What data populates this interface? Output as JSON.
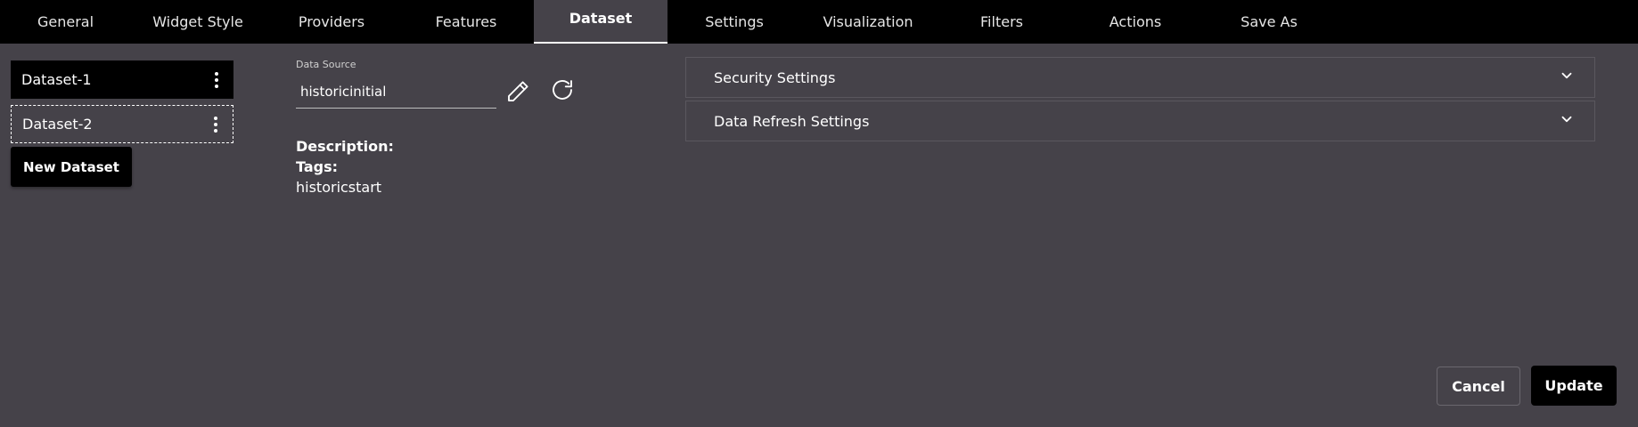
{
  "tabs": [
    {
      "label": "General"
    },
    {
      "label": "Widget Style"
    },
    {
      "label": "Providers"
    },
    {
      "label": "Features"
    },
    {
      "label": "Dataset"
    },
    {
      "label": "Settings"
    },
    {
      "label": "Visualization"
    },
    {
      "label": "Filters"
    },
    {
      "label": "Actions"
    },
    {
      "label": "Save As"
    }
  ],
  "active_tab": "Dataset",
  "datasets": [
    {
      "name": "Dataset-1",
      "menu_icon": "kebab-icon"
    },
    {
      "name": "Dataset-2",
      "menu_icon": "kebab-icon"
    }
  ],
  "new_dataset_label": "New Dataset",
  "data_source": {
    "label": "Data Source",
    "value": "historicinitial",
    "edit_icon": "pencil-icon",
    "refresh_icon": "refresh-icon"
  },
  "meta": {
    "description_label": "Description:",
    "tags_label": "Tags:",
    "tags_value": "historicstart"
  },
  "accordions": [
    {
      "title": "Security Settings",
      "icon": "chevron-down-icon"
    },
    {
      "title": "Data Refresh Settings",
      "icon": "chevron-down-icon"
    }
  ],
  "footer": {
    "cancel_label": "Cancel",
    "update_label": "Update"
  },
  "colors": {
    "background": "#454249",
    "tabbar": "#000000",
    "text": "#ffffff"
  }
}
